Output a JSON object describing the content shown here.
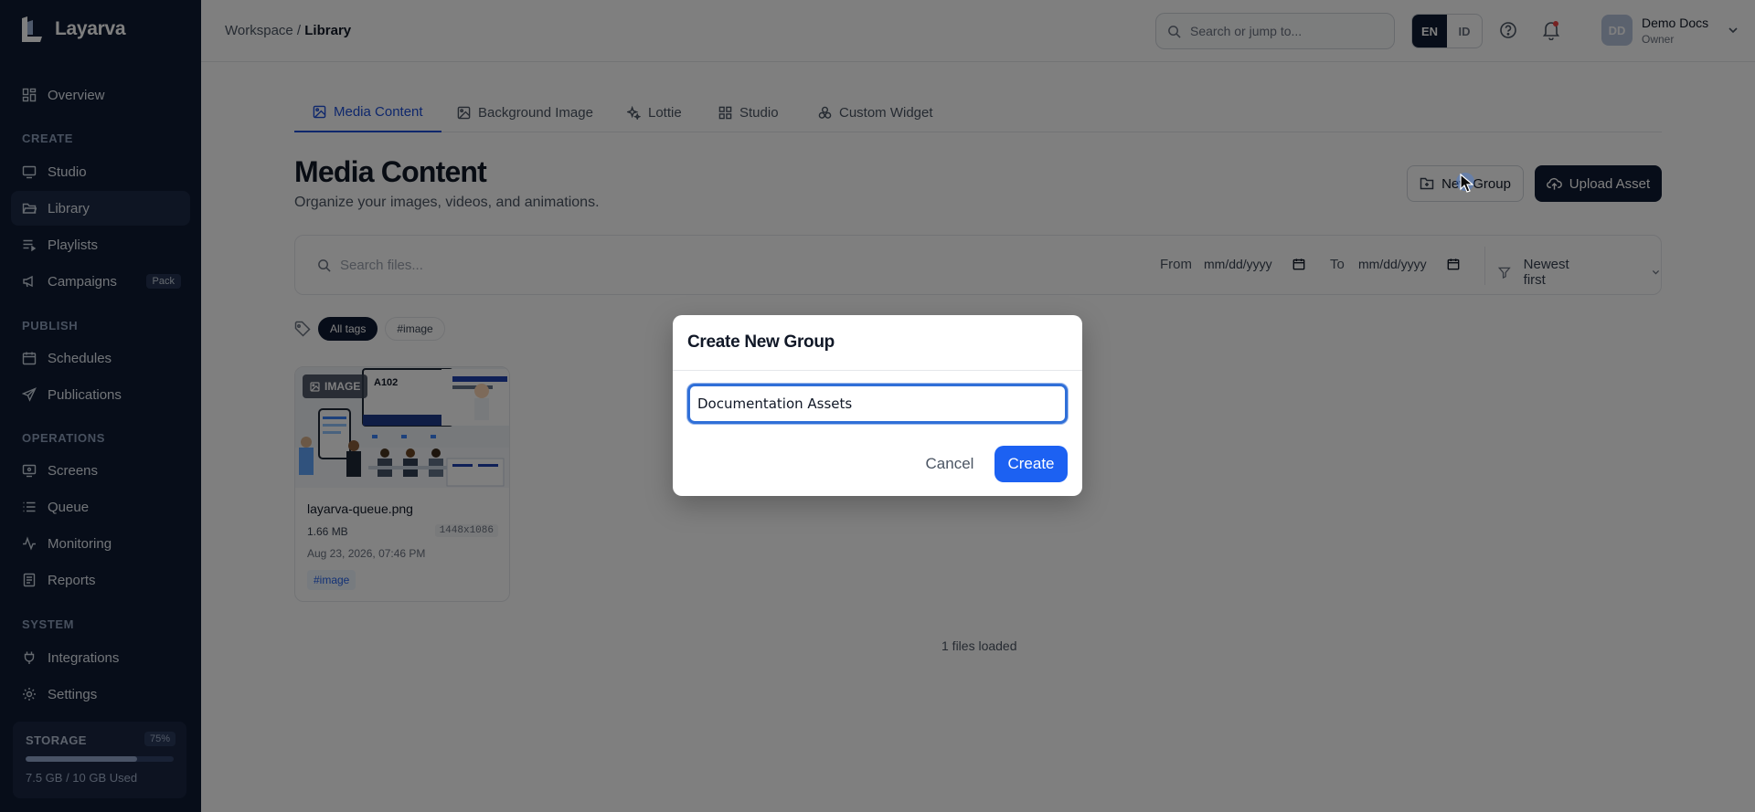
{
  "brand": {
    "name": "Layarva"
  },
  "sidebar": {
    "overview": "Overview",
    "create_label": "CREATE",
    "studio": "Studio",
    "library": "Library",
    "playlists": "Playlists",
    "campaigns": "Campaigns",
    "campaigns_badge": "Pack",
    "publish_label": "PUBLISH",
    "schedules": "Schedules",
    "publications": "Publications",
    "operations_label": "OPERATIONS",
    "screens": "Screens",
    "queue": "Queue",
    "monitoring": "Monitoring",
    "reports": "Reports",
    "system_label": "SYSTEM",
    "integrations": "Integrations",
    "settings": "Settings",
    "storage": {
      "label": "STORAGE",
      "percent": "75%",
      "fraction": 0.75,
      "used": "7.5 GB / 10 GB Used"
    }
  },
  "topbar": {
    "breadcrumb_root": "Workspace /",
    "breadcrumb_current": "Library",
    "search_placeholder": "Search or jump to...",
    "lang_en": "EN",
    "lang_id": "ID",
    "user_initials": "DD",
    "user_name": "Demo Docs",
    "user_role": "Owner"
  },
  "tabs": {
    "media": "Media Content",
    "background": "Background Image",
    "lottie": "Lottie",
    "studio": "Studio",
    "widget": "Custom Widget"
  },
  "page": {
    "title": "Media Content",
    "subtitle": "Organize your images, videos, and animations.",
    "new_group": "New Group",
    "upload": "Upload Asset"
  },
  "filters": {
    "search_placeholder": "Search files...",
    "from": "From",
    "to": "To",
    "date_placeholder": "mm/dd/yyyy",
    "sort": "Newest first"
  },
  "tags": {
    "all": "All tags",
    "image": "#image"
  },
  "file": {
    "type": "IMAGE",
    "name": "layarva-queue.png",
    "size": "1.66 MB",
    "dimensions": "1448x1086",
    "date": "Aug 23, 2026, 07:46 PM",
    "tag": "#image"
  },
  "files_loaded": "1 files loaded",
  "modal": {
    "title": "Create New Group",
    "input_value": "Documentation Assets",
    "cancel": "Cancel",
    "create": "Create"
  },
  "colors": {
    "sidebar_bg": "#0f1b33",
    "accent": "#1c61f2",
    "active_tab": "#1d4ed8"
  }
}
